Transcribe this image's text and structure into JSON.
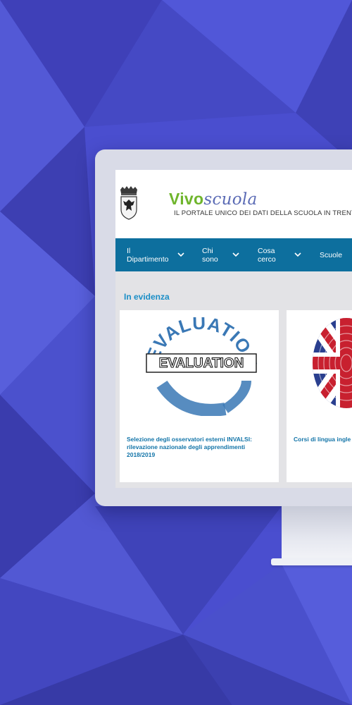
{
  "site": {
    "brand_part1": "Vivo",
    "brand_part2": "scuola",
    "tagline": "IL PORTALE UNICO DEI DATI DELLA SCUOLA IN TRENTINO"
  },
  "nav": {
    "items": [
      {
        "line1": "Il",
        "line2": "Dipartimento"
      },
      {
        "line1": "Chi",
        "line2": "sono"
      },
      {
        "line1": "Cosa",
        "line2": "cerco"
      },
      {
        "line1": "Scuole",
        "line2": ""
      }
    ]
  },
  "content": {
    "section_title": "In evidenza",
    "cards": [
      {
        "image_text": "EVALUATION",
        "title": "Selezione degli osservatori esterni INVALSI: rilevazione nazionale degli apprendimenti 2018/2019"
      },
      {
        "title": "Corsi di lingua ingle SECONDA EDIZIONI"
      }
    ]
  },
  "colors": {
    "background": "#4a4fd0",
    "nav": "#0d6f9e",
    "accent": "#1a8ec7",
    "brand_green": "#6fb52c"
  }
}
